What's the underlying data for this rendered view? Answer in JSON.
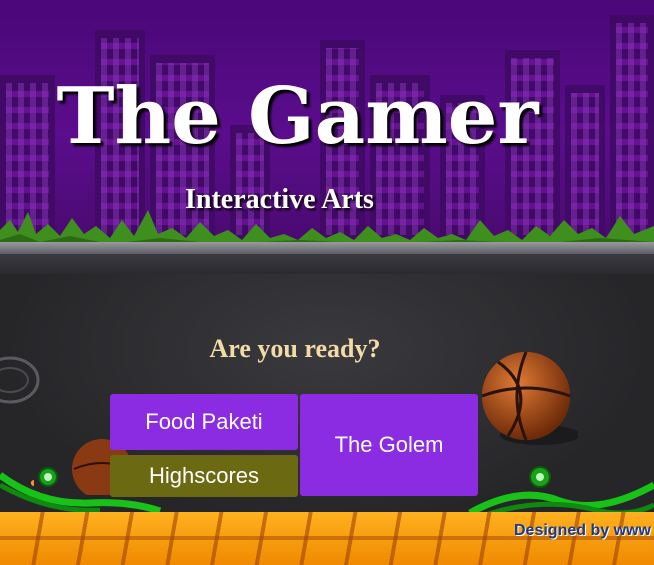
{
  "header": {
    "title": "The Gamer",
    "subtitle": "Interactive Arts"
  },
  "main": {
    "prompt": "Are you ready?",
    "buttons": {
      "food": "Food Paketi",
      "golem": "The Golem",
      "highscores": "Highscores"
    }
  },
  "footer": {
    "credit": "Designed by www"
  },
  "colors": {
    "sky": "#4a0778",
    "button_primary": "#8b2be2",
    "button_secondary": "#6b6a12",
    "prompt_text": "#f3dba8",
    "floor": "#f59a10"
  },
  "icons": [
    "basketball-icon",
    "hoop-icon",
    "snail-icon"
  ]
}
